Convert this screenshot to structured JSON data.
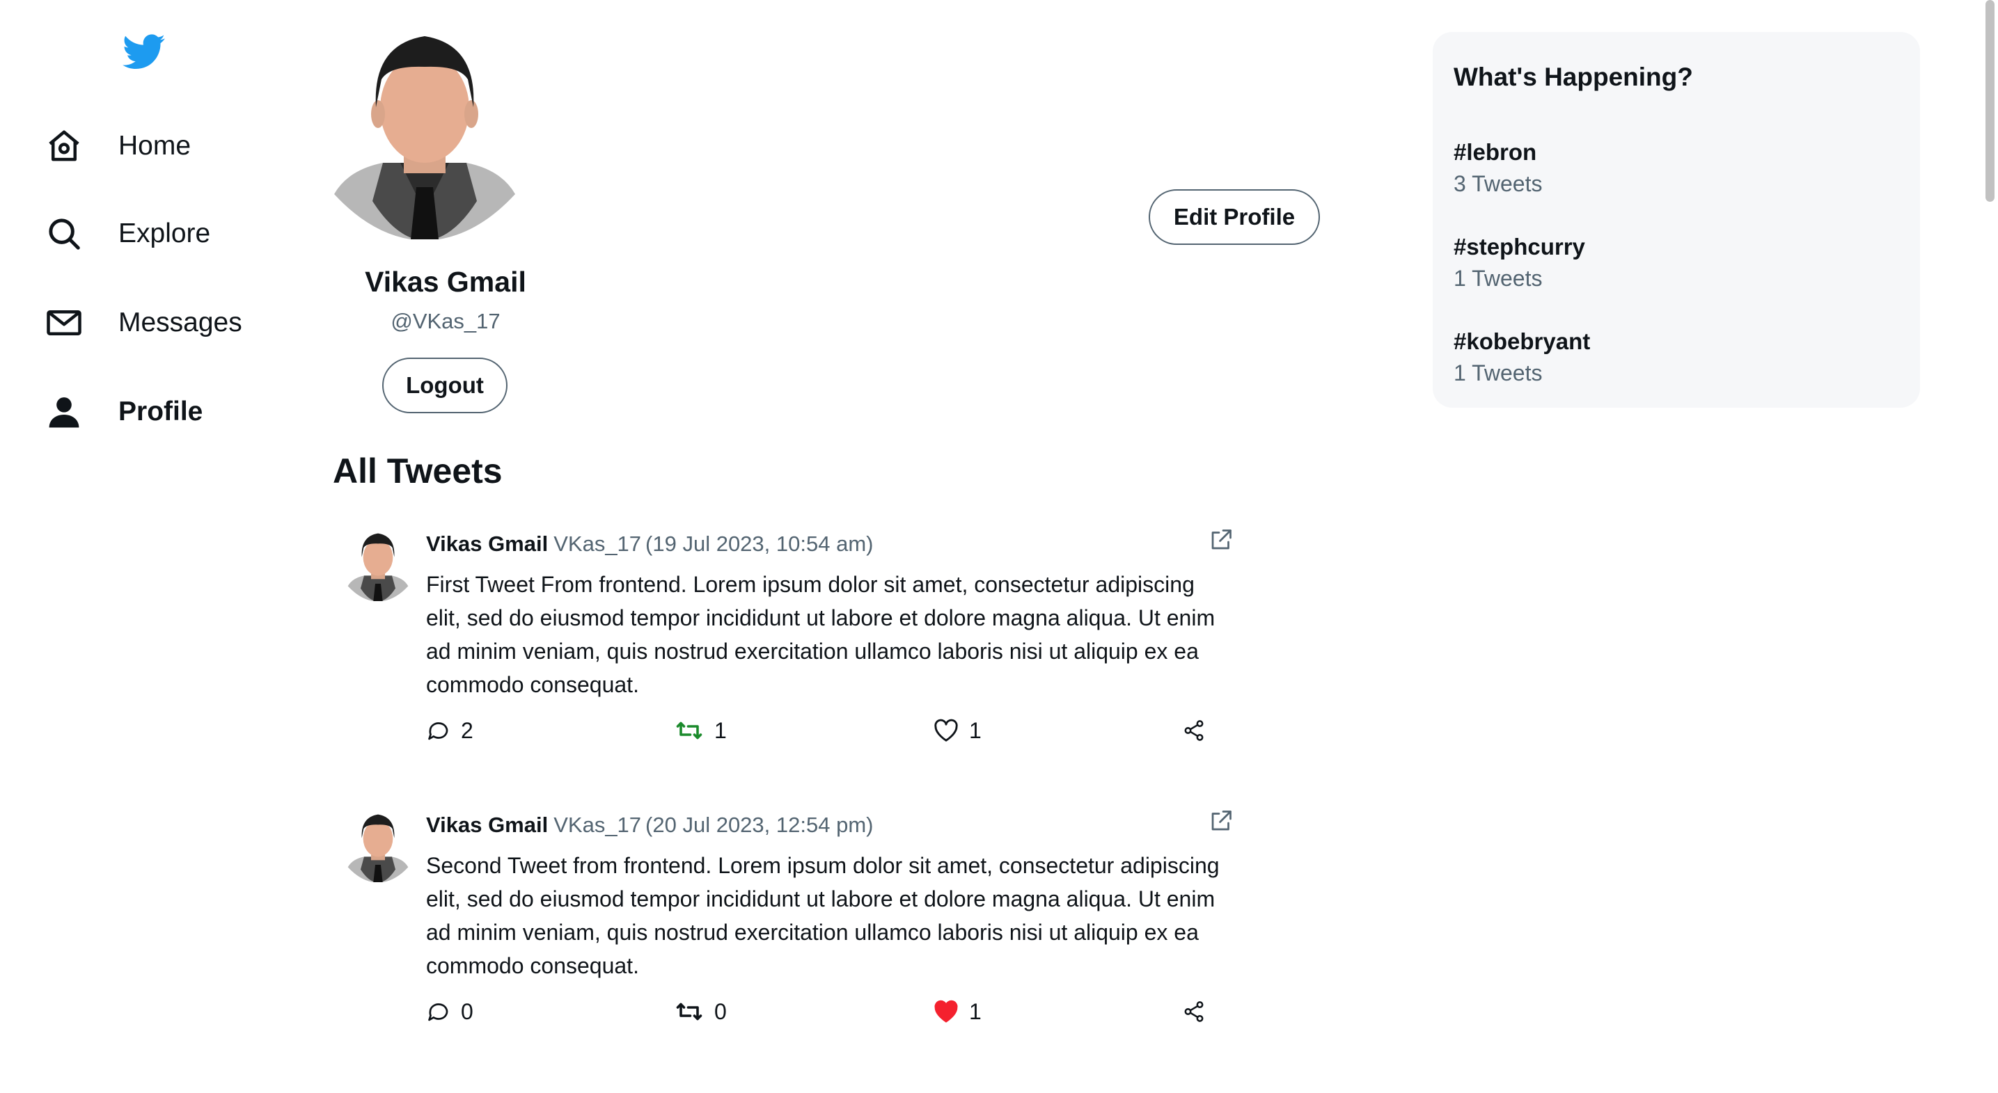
{
  "brand": {
    "logo_icon": "twitter-bird-icon",
    "color": "#1d9bf0"
  },
  "nav": {
    "items": [
      {
        "label": "Home",
        "icon": "home-icon"
      },
      {
        "label": "Explore",
        "icon": "search-icon"
      },
      {
        "label": "Messages",
        "icon": "mail-icon"
      },
      {
        "label": "Profile",
        "icon": "user-icon",
        "active": true
      }
    ]
  },
  "profile": {
    "name": "Vikas Gmail",
    "handle": "@VKas_17",
    "logout_label": "Logout",
    "edit_label": "Edit Profile"
  },
  "tweets_section": {
    "title": "All Tweets"
  },
  "tweets": [
    {
      "author": "Vikas Gmail",
      "handle": "VKas_17",
      "time": "(19 Jul 2023, 10:54 am)",
      "text": "First Tweet From frontend. Lorem ipsum dolor sit amet, consectetur adipiscing elit, sed do eiusmod tempor incididunt ut labore et dolore magna aliqua. Ut enim ad minim veniam, quis nostrud exercitation ullamco laboris nisi ut aliquip ex ea commodo consequat.",
      "replies": "2",
      "retweets": "1",
      "likes": "1",
      "retweeted": true,
      "liked": false
    },
    {
      "author": "Vikas Gmail",
      "handle": "VKas_17",
      "time": "(20 Jul 2023, 12:54 pm)",
      "text": "Second Tweet from frontend. Lorem ipsum dolor sit amet, consectetur adipiscing elit, sed do eiusmod tempor incididunt ut labore et dolore magna aliqua. Ut enim ad minim veniam, quis nostrud exercitation ullamco laboris nisi ut aliquip ex ea commodo consequat.",
      "replies": "0",
      "retweets": "0",
      "likes": "1",
      "retweeted": false,
      "liked": true
    }
  ],
  "trends": {
    "title": "What's Happening?",
    "items": [
      {
        "tag": "#lebron",
        "count": "3 Tweets"
      },
      {
        "tag": "#stephcurry",
        "count": "1 Tweets"
      },
      {
        "tag": "#kobebryant",
        "count": "1 Tweets"
      }
    ]
  },
  "colors": {
    "retweet_active": "#1a8a2b",
    "like_active": "#f4212e",
    "muted_text": "#536471",
    "panel_bg": "#f6f7f9"
  }
}
